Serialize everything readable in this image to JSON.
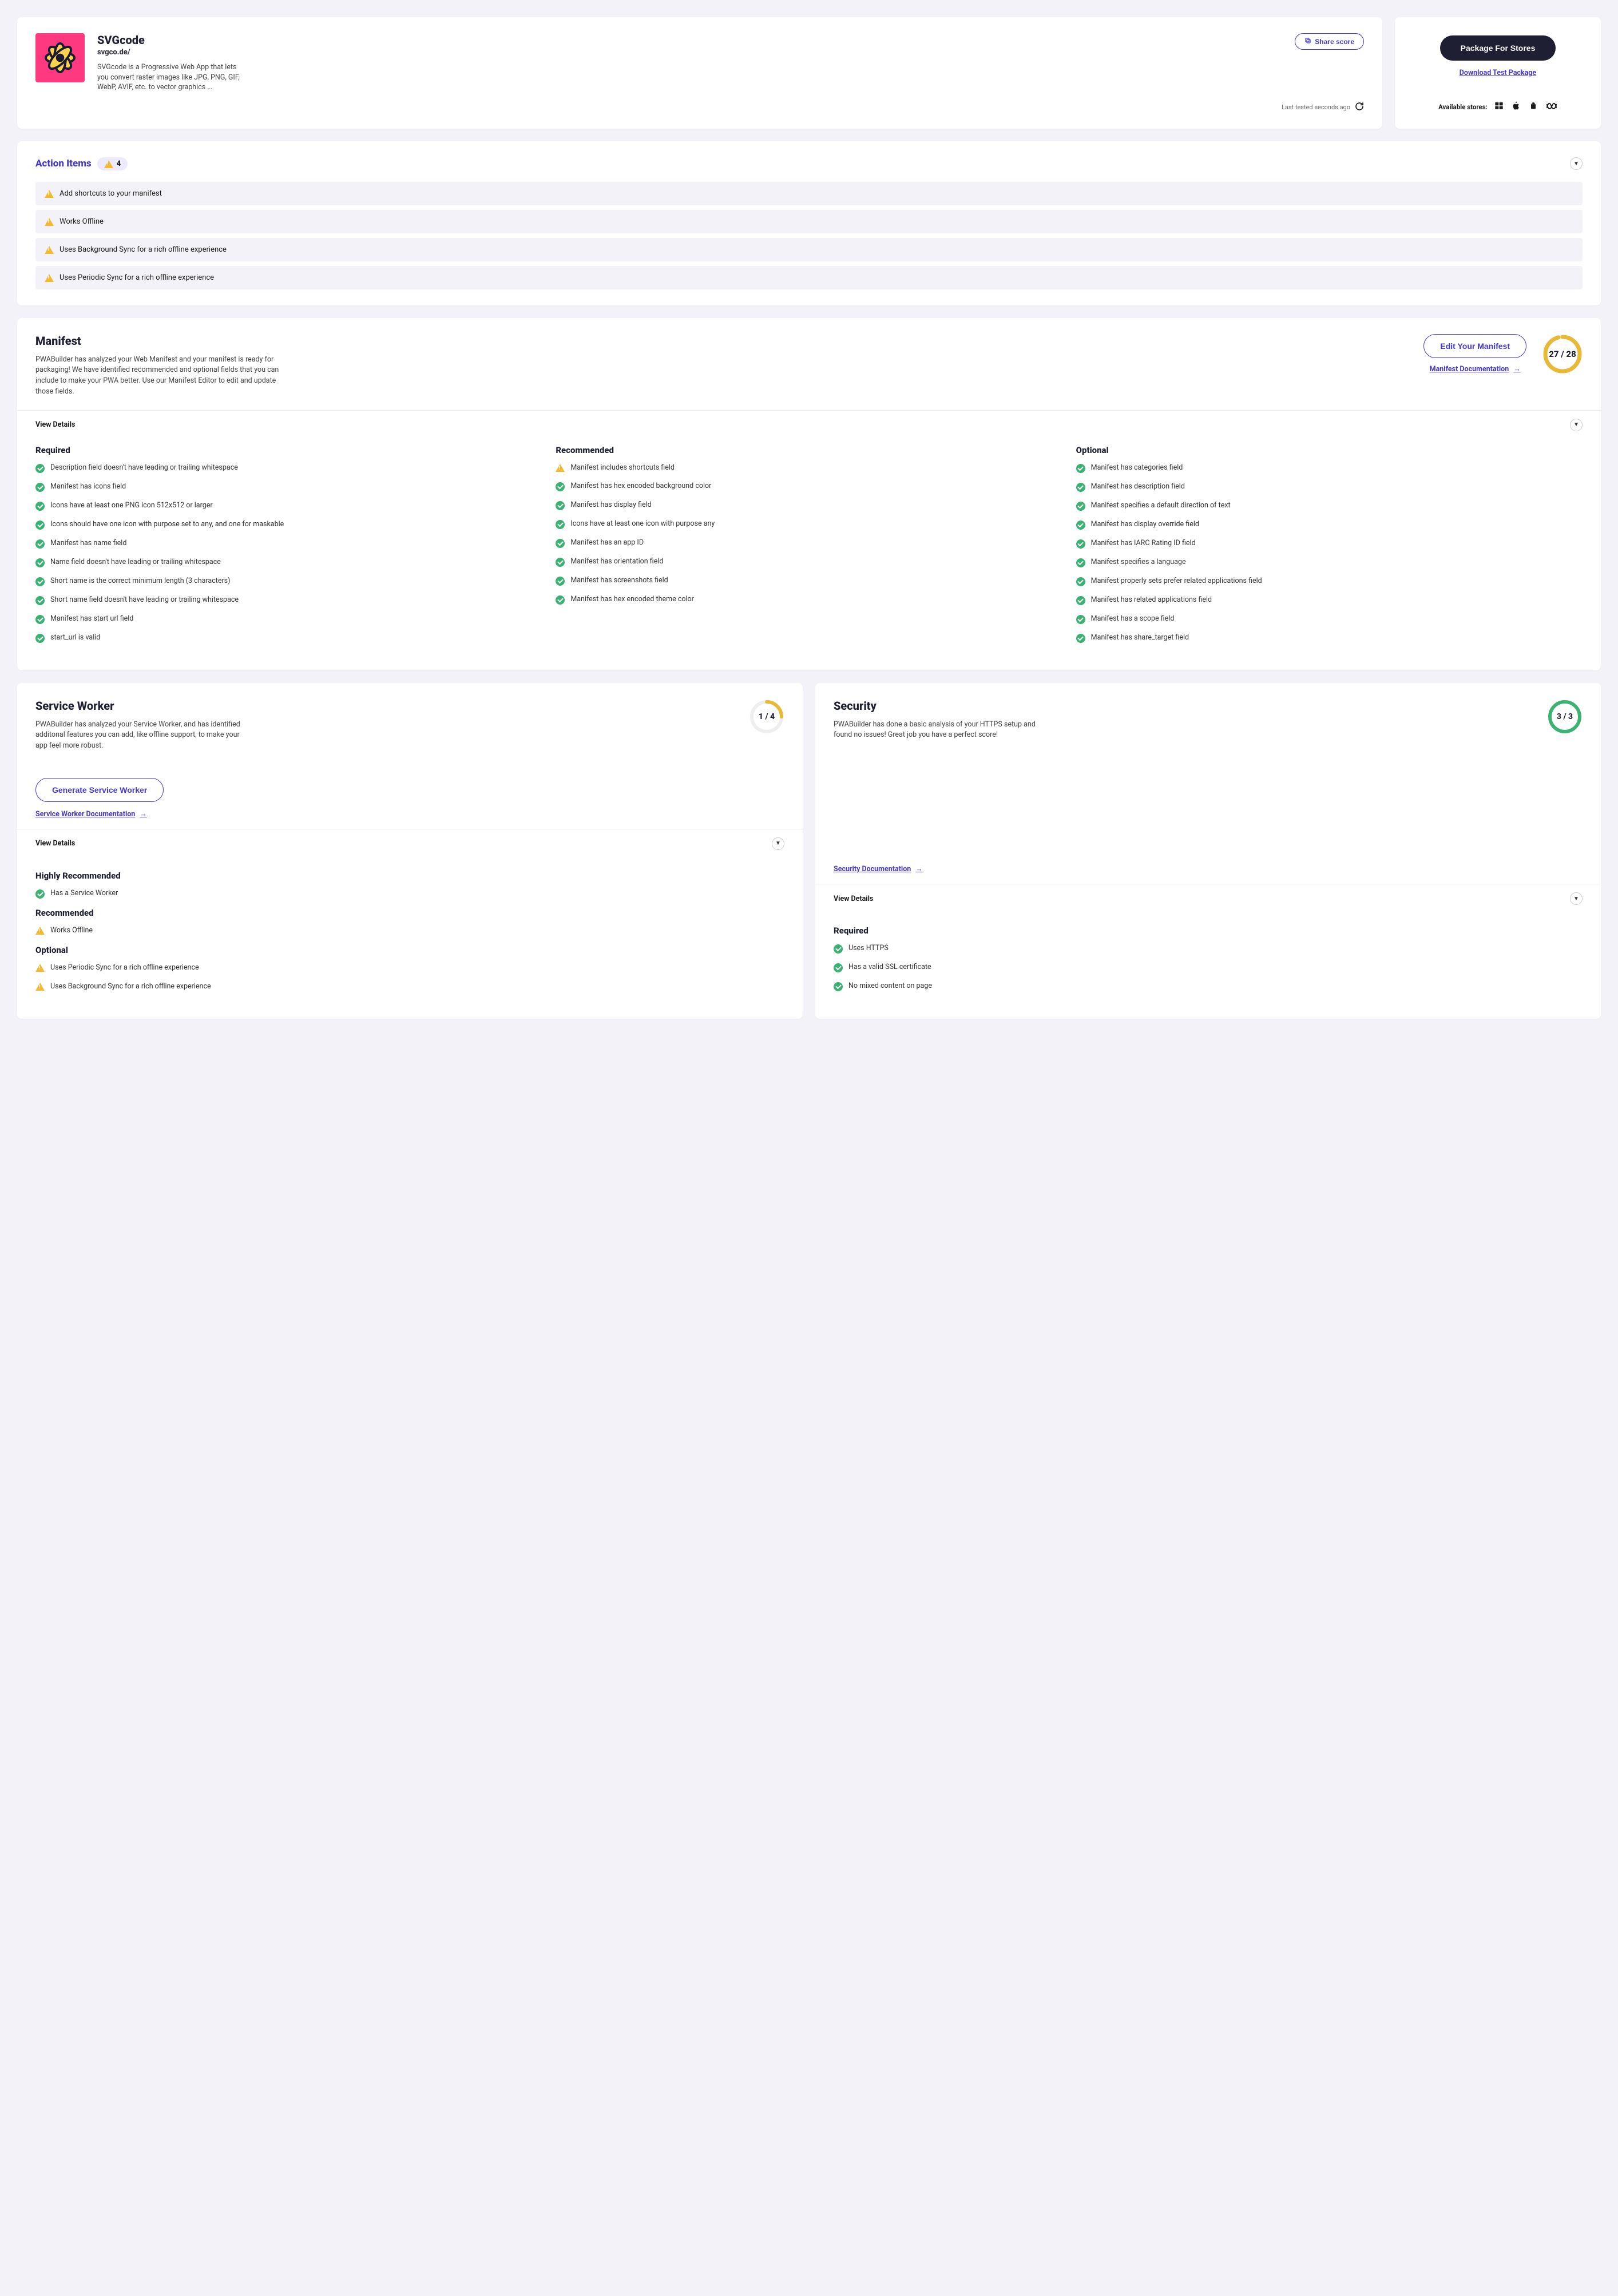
{
  "header": {
    "title": "SVGcode",
    "url": "svgco.de/",
    "desc": "SVGcode is a Progressive Web App that lets you convert raster images like JPG, PNG, GIF, WebP, AVIF, etc. to vector graphics …",
    "share": "Share score",
    "lastTested": "Last tested seconds ago"
  },
  "pkg": {
    "button": "Package For Stores",
    "download": "Download Test Package",
    "storesLabel": "Available stores:"
  },
  "actions": {
    "title": "Action Items",
    "count": "4",
    "items": [
      "Add shortcuts to your manifest",
      "Works Offline",
      "Uses Background Sync for a rich offline experience",
      "Uses Periodic Sync for a rich offline experience"
    ]
  },
  "manifest": {
    "title": "Manifest",
    "desc": "PWABuilder has analyzed your Web Manifest and your manifest is ready for packaging! We have identified recommended and optional fields that you can include to make your PWA better. Use our Manifest Editor to edit and update those fields.",
    "editBtn": "Edit Your Manifest",
    "docLink": "Manifest Documentation",
    "score": "27 / 28",
    "viewDetails": "View Details",
    "required": {
      "title": "Required",
      "items": [
        {
          "s": "ok",
          "t": "Description field doesn't have leading or trailing whitespace"
        },
        {
          "s": "ok",
          "t": "Manifest has icons field"
        },
        {
          "s": "ok",
          "t": "Icons have at least one PNG icon 512x512 or larger"
        },
        {
          "s": "ok",
          "t": "Icons should have one icon with purpose set to any, and one for maskable"
        },
        {
          "s": "ok",
          "t": "Manifest has name field"
        },
        {
          "s": "ok",
          "t": "Name field doesn't have leading or trailing whitespace"
        },
        {
          "s": "ok",
          "t": "Short name is the correct minimum length (3 characters)"
        },
        {
          "s": "ok",
          "t": "Short name field doesn't have leading or trailing whitespace"
        },
        {
          "s": "ok",
          "t": "Manifest has start url field"
        },
        {
          "s": "ok",
          "t": "start_url is valid"
        }
      ]
    },
    "recommended": {
      "title": "Recommended",
      "items": [
        {
          "s": "warn",
          "t": "Manifest includes shortcuts field"
        },
        {
          "s": "ok",
          "t": "Manifest has hex encoded background color"
        },
        {
          "s": "ok",
          "t": "Manifest has display field"
        },
        {
          "s": "ok",
          "t": "Icons have at least one icon with purpose any"
        },
        {
          "s": "ok",
          "t": "Manifest has an app ID"
        },
        {
          "s": "ok",
          "t": "Manifest has orientation field"
        },
        {
          "s": "ok",
          "t": "Manifest has screenshots field"
        },
        {
          "s": "ok",
          "t": "Manifest has hex encoded theme color"
        }
      ]
    },
    "optional": {
      "title": "Optional",
      "items": [
        {
          "s": "ok",
          "t": "Manifest has categories field"
        },
        {
          "s": "ok",
          "t": "Manifest has description field"
        },
        {
          "s": "ok",
          "t": "Manifest specifies a default direction of text"
        },
        {
          "s": "ok",
          "t": "Manifest has display override field"
        },
        {
          "s": "ok",
          "t": "Manifest has IARC Rating ID field"
        },
        {
          "s": "ok",
          "t": "Manifest specifies a language"
        },
        {
          "s": "ok",
          "t": "Manifest properly sets prefer related applications field"
        },
        {
          "s": "ok",
          "t": "Manifest has related applications field"
        },
        {
          "s": "ok",
          "t": "Manifest has a scope field"
        },
        {
          "s": "ok",
          "t": "Manifest has share_target field"
        }
      ]
    }
  },
  "sw": {
    "title": "Service Worker",
    "desc": "PWABuilder has analyzed your Service Worker, and has identified additonal features you can add, like offline support, to make your app feel more robust.",
    "score": "1 / 4",
    "genBtn": "Generate Service Worker",
    "docLink": "Service Worker Documentation",
    "viewDetails": "View Details",
    "groups": [
      {
        "title": "Highly Recommended",
        "items": [
          {
            "s": "ok",
            "t": "Has a Service Worker"
          }
        ]
      },
      {
        "title": "Recommended",
        "items": [
          {
            "s": "warn",
            "t": "Works Offline"
          }
        ]
      },
      {
        "title": "Optional",
        "items": [
          {
            "s": "warn",
            "t": "Uses Periodic Sync for a rich offline experience"
          },
          {
            "s": "warn",
            "t": "Uses Background Sync for a rich offline experience"
          }
        ]
      }
    ]
  },
  "sec": {
    "title": "Security",
    "desc": "PWABuilder has done a basic analysis of your HTTPS setup and found no issues! Great job you have a perfect score!",
    "score": "3 / 3",
    "docLink": "Security Documentation",
    "viewDetails": "View Details",
    "groups": [
      {
        "title": "Required",
        "items": [
          {
            "s": "ok",
            "t": "Uses HTTPS"
          },
          {
            "s": "ok",
            "t": "Has a valid SSL certificate"
          },
          {
            "s": "ok",
            "t": "No mixed content on page"
          }
        ]
      }
    ]
  }
}
